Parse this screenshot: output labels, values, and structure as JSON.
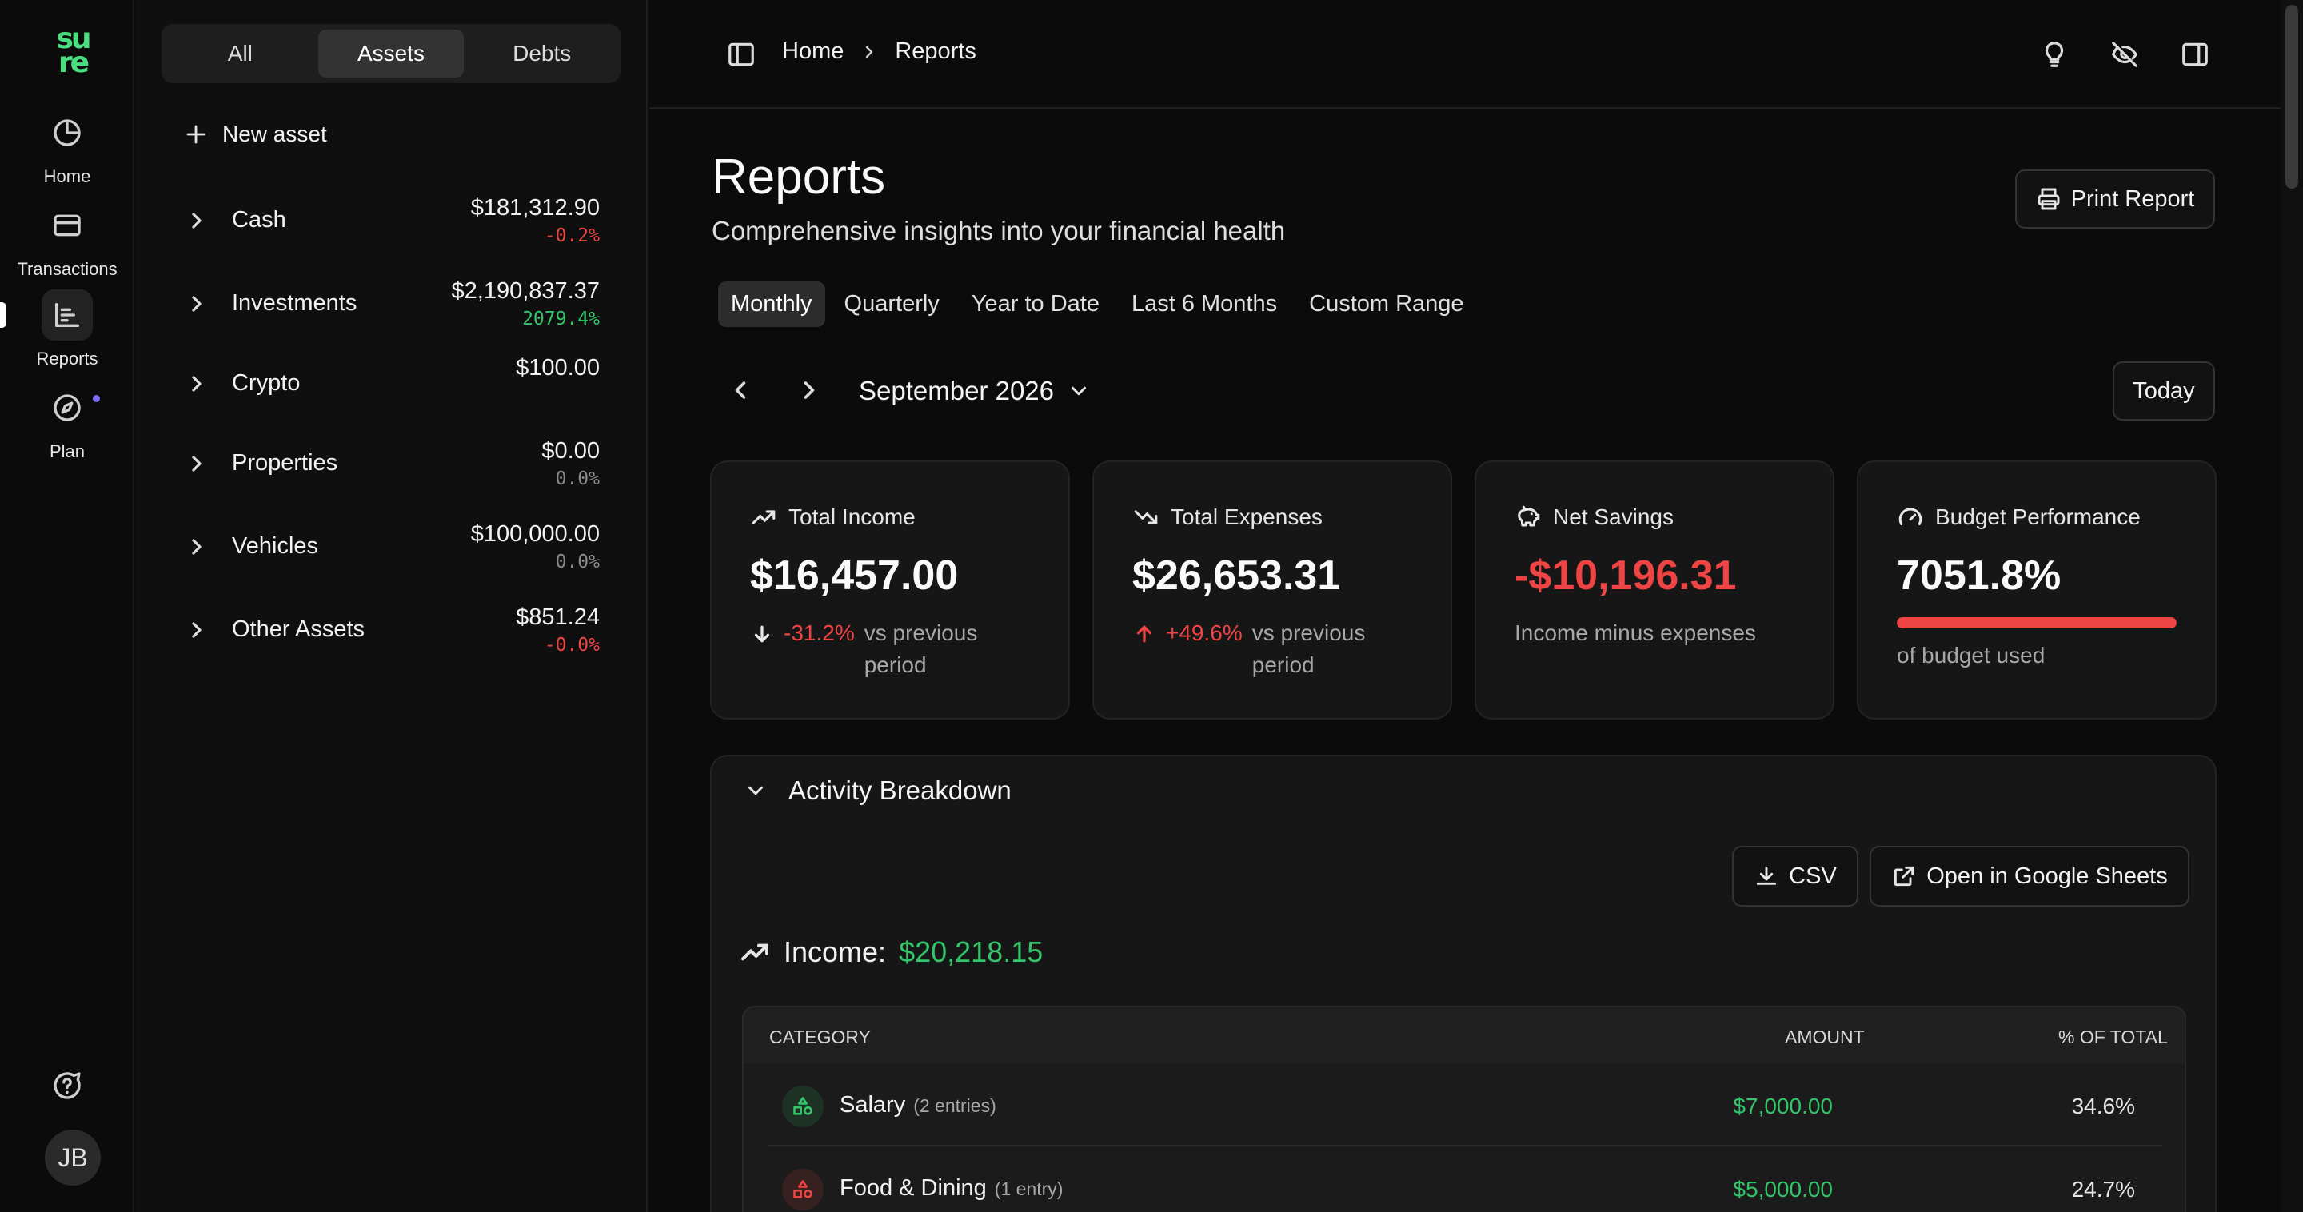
{
  "brand": {
    "logo_top": "su",
    "logo_bottom": "re",
    "accent": "#4ade80"
  },
  "rail": {
    "items": [
      {
        "label": "Home",
        "icon": "pie-chart-icon"
      },
      {
        "label": "Transactions",
        "icon": "credit-card-icon"
      },
      {
        "label": "Reports",
        "icon": "bar-chart-icon",
        "active": true
      },
      {
        "label": "Plan",
        "icon": "compass-icon"
      }
    ],
    "avatar_initials": "JB"
  },
  "accounts": {
    "tabs": [
      "All",
      "Assets",
      "Debts"
    ],
    "active_tab": "Assets",
    "new_asset_label": "New asset",
    "groups": [
      {
        "name": "Cash",
        "value": "$181,312.90",
        "change": "-0.2%",
        "change_color": "#ef4444"
      },
      {
        "name": "Investments",
        "value": "$2,190,837.37",
        "change": "2079.4%",
        "change_color": "#34c46a"
      },
      {
        "name": "Crypto",
        "value": "$100.00",
        "change": "",
        "change_color": "#a8a8a8"
      },
      {
        "name": "Properties",
        "value": "$0.00",
        "change": "0.0%",
        "change_color": "#8a8a8a"
      },
      {
        "name": "Vehicles",
        "value": "$100,000.00",
        "change": "0.0%",
        "change_color": "#8a8a8a"
      },
      {
        "name": "Other Assets",
        "value": "$851.24",
        "change": "-0.0%",
        "change_color": "#ef4444"
      }
    ]
  },
  "header": {
    "breadcrumb": [
      "Home",
      "Reports"
    ]
  },
  "page": {
    "title": "Reports",
    "subtitle": "Comprehensive insights into your financial health",
    "print_label": "Print Report",
    "periods": [
      "Monthly",
      "Quarterly",
      "Year to Date",
      "Last 6 Months",
      "Custom Range"
    ],
    "active_period": "Monthly",
    "current_month": "September 2026",
    "today_label": "Today"
  },
  "summary": {
    "income": {
      "label": "Total Income",
      "value": "$16,457.00",
      "change": "-31.2%",
      "change_note": "vs previous period"
    },
    "expenses": {
      "label": "Total Expenses",
      "value": "$26,653.31",
      "change": "+49.6%",
      "change_note": "vs previous period"
    },
    "savings": {
      "label": "Net Savings",
      "value": "-$10,196.31",
      "note": "Income minus expenses"
    },
    "budget": {
      "label": "Budget Performance",
      "value": "7051.8%",
      "fill_fraction": 1.0,
      "note": "of budget used"
    }
  },
  "breakdown": {
    "title": "Activity Breakdown",
    "csv_label": "CSV",
    "sheets_label": "Open in Google Sheets",
    "income_label": "Income:",
    "income_total": "$20,218.15",
    "columns": [
      "CATEGORY",
      "AMOUNT",
      "% OF TOTAL"
    ],
    "rows": [
      {
        "name": "Salary",
        "entries": "(2 entries)",
        "amount": "$7,000.00",
        "pct": "34.6%",
        "badge_color": "#34c46a"
      },
      {
        "name": "Food & Dining",
        "entries": "(1 entry)",
        "amount": "$5,000.00",
        "pct": "24.7%",
        "badge_color": "#ef4444"
      }
    ]
  },
  "colors": {
    "negative": "#ef4444",
    "positive": "#34c46a"
  }
}
